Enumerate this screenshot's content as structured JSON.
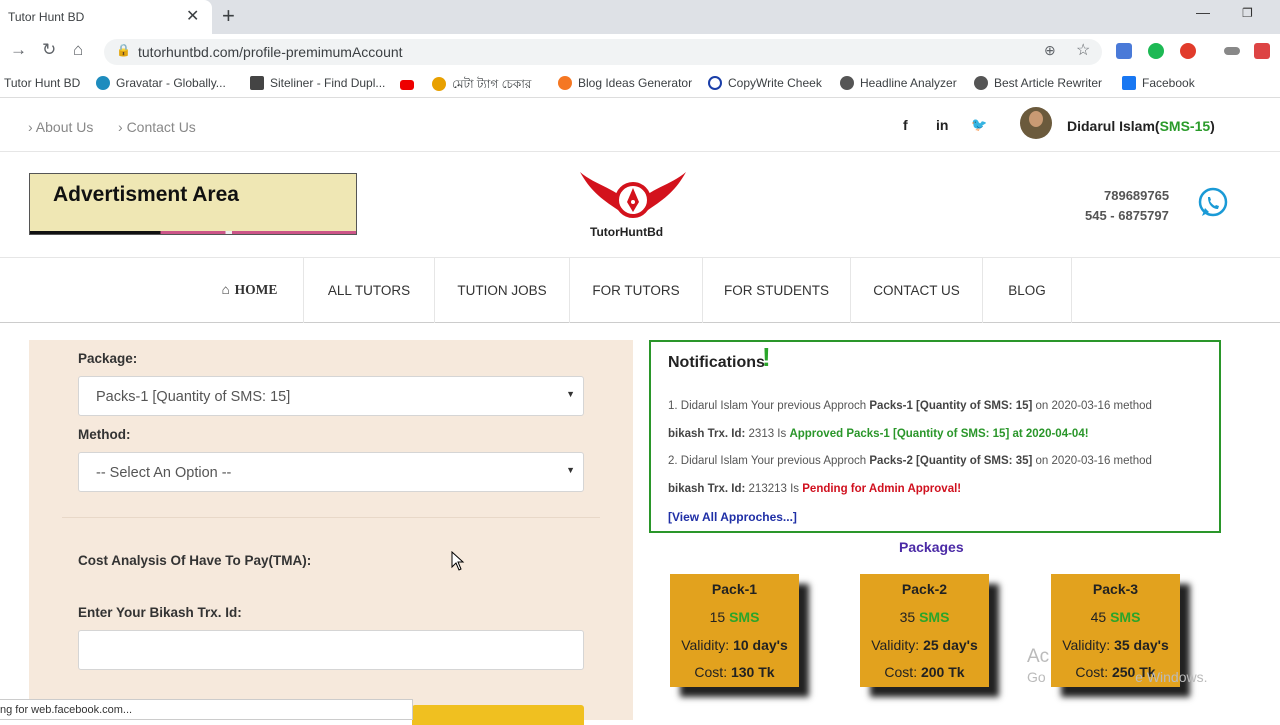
{
  "browser": {
    "tab_title": "Tutor Hunt BD",
    "url": "tutorhuntbd.com/profile-premimumAccount",
    "bookmarks": [
      {
        "label": "Tutor Hunt BD"
      },
      {
        "label": "Gravatar - Globally..."
      },
      {
        "label": "Siteliner - Find Dupl..."
      },
      {
        "label": "মেটা ট্যাগ চেকার"
      },
      {
        "label": "Blog Ideas Generator"
      },
      {
        "label": "CopyWrite Cheek"
      },
      {
        "label": "Headline Analyzer"
      },
      {
        "label": "Best Article Rewriter"
      },
      {
        "label": "Facebook"
      }
    ],
    "status_text": "ng for web.facebook.com..."
  },
  "topbar": {
    "links": [
      "About Us",
      "Contact Us"
    ],
    "user_name": "Didarul Islam(",
    "user_sms": "SMS-15",
    "user_close": ")"
  },
  "header": {
    "ad_title": "Advertisment Area",
    "logo_text": "TutorHuntBd",
    "phone1": "789689765",
    "phone2": "545 - 6875797"
  },
  "nav": [
    "HOME",
    "ALL TUTORS",
    "TUTION JOBS",
    "FOR TUTORS",
    "FOR STUDENTS",
    "CONTACT US",
    "BLOG"
  ],
  "form": {
    "package_label": "Package:",
    "package_value": "Packs-1 [Quantity of SMS: 15]",
    "method_label": "Method:",
    "method_value": "-- Select An Option --",
    "cost_label": "Cost Analysis Of Have To Pay(TMA):",
    "trx_label": "Enter Your Bikash Trx. Id:",
    "trx_value": ""
  },
  "notifications": {
    "title": "Notifications",
    "bang": "!",
    "items": [
      {
        "l1_a": "1. Didarul Islam Your previous Approch ",
        "l1_b": "Packs-1 [Quantity of SMS: 15]",
        "l1_c": " on 2020-03-16 method",
        "l2_a": "bikash Trx. Id: ",
        "l2_b": "2313 Is ",
        "l2_c": "Approved Packs-1 [Quantity of SMS: 15] at 2020-04-04!"
      },
      {
        "l1_a": "2. Didarul Islam Your previous Approch ",
        "l1_b": "Packs-2 [Quantity of SMS: 35]",
        "l1_c": " on 2020-03-16 method",
        "l2_a": "bikash Trx. Id: ",
        "l2_b": "213213 Is ",
        "l2_c": "Pending for Admin Approval!"
      }
    ],
    "view_all": "[View All Approches...]"
  },
  "packages": {
    "heading": "Packages",
    "items": [
      {
        "name": "Pack-1",
        "count": "15",
        "sms": "SMS",
        "validity_label": "Validity: ",
        "validity": "10 day's",
        "cost_label": "Cost: ",
        "cost": "130 Tk"
      },
      {
        "name": "Pack-2",
        "count": "35",
        "sms": "SMS",
        "validity_label": "Validity: ",
        "validity": "25 day's",
        "cost_label": "Cost: ",
        "cost": "200 Tk"
      },
      {
        "name": "Pack-3",
        "count": "45",
        "sms": "SMS",
        "validity_label": "Validity: ",
        "validity": "35 day's",
        "cost_label": "Cost: ",
        "cost": "250 Tk"
      }
    ]
  },
  "watermark": {
    "line1": "Ac",
    "line2": "Go                       e Windows."
  }
}
